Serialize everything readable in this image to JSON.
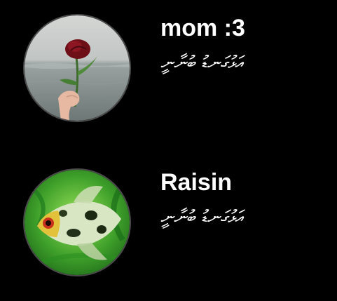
{
  "contacts": [
    {
      "name": "mom :3",
      "status": "އަޅުގަނޑު ބުނާނީ",
      "avatar_icon": "rose-photo"
    },
    {
      "name": "Raisin",
      "status": "އަޅުގަނޑު ބުނާނީ",
      "avatar_icon": "fish-photo"
    }
  ],
  "colors": {
    "background": "#000000",
    "text": "#ffffff",
    "avatar_border": "#4b4b4b"
  }
}
